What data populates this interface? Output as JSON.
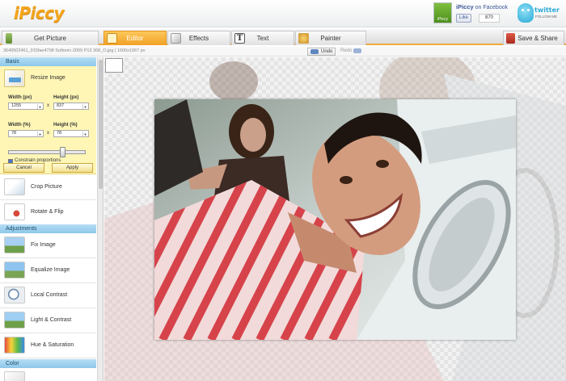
{
  "app": {
    "logo": "iPiccy"
  },
  "social": {
    "fb_thumb_label": "iPiccy",
    "fb_title_bold": "iPiccy",
    "fb_title_rest": " on Facebook",
    "fb_like": "Like",
    "fb_count": "870",
    "tw_label": "twitter",
    "tw_sub": "FOLLOW ME"
  },
  "tabs": [
    {
      "label": "Get Picture",
      "icon": "phone-icon"
    },
    {
      "label": "Editor",
      "icon": "tools-icon",
      "active": true
    },
    {
      "label": "Effects",
      "icon": "brush-icon"
    },
    {
      "label": "Text",
      "icon": "text-icon"
    },
    {
      "label": "Painter",
      "icon": "palette-icon"
    },
    {
      "label": "Save & Share",
      "icon": "save-icon"
    }
  ],
  "filebar": {
    "filename": "3649502461_915fae4708 Softonic-2009 P13 368_O.jpg | 1600x1067 px",
    "undo": "Undo",
    "redo": "Redo"
  },
  "sidebar": {
    "basic": "Basic",
    "resize": {
      "title": "Resize Image",
      "width_px_label": "Width (px)",
      "height_px_label": "Height (px)",
      "width_px": "1255",
      "height_px": "837",
      "width_pct_label": "Width (%)",
      "height_pct_label": "Height (%)",
      "width_pct": "78",
      "height_pct": "78",
      "multiply": "x",
      "constrain": "Constrain proportions",
      "cancel": "Cancel",
      "apply": "Apply",
      "slider_value": 0.72
    },
    "basic_items": [
      "Crop Picture",
      "Rotate & Flip"
    ],
    "adjustments": "Adjustments",
    "adjust_items": [
      "Fix Image",
      "Equalize Image",
      "Local Contrast",
      "Light & Contrast",
      "Hue & Saturation"
    ],
    "color": "Color"
  },
  "colors": {
    "accent": "#f4a51c",
    "section": "#a8d6f1",
    "panel": "#fff6b6",
    "active_tab": "#f7b33e"
  }
}
